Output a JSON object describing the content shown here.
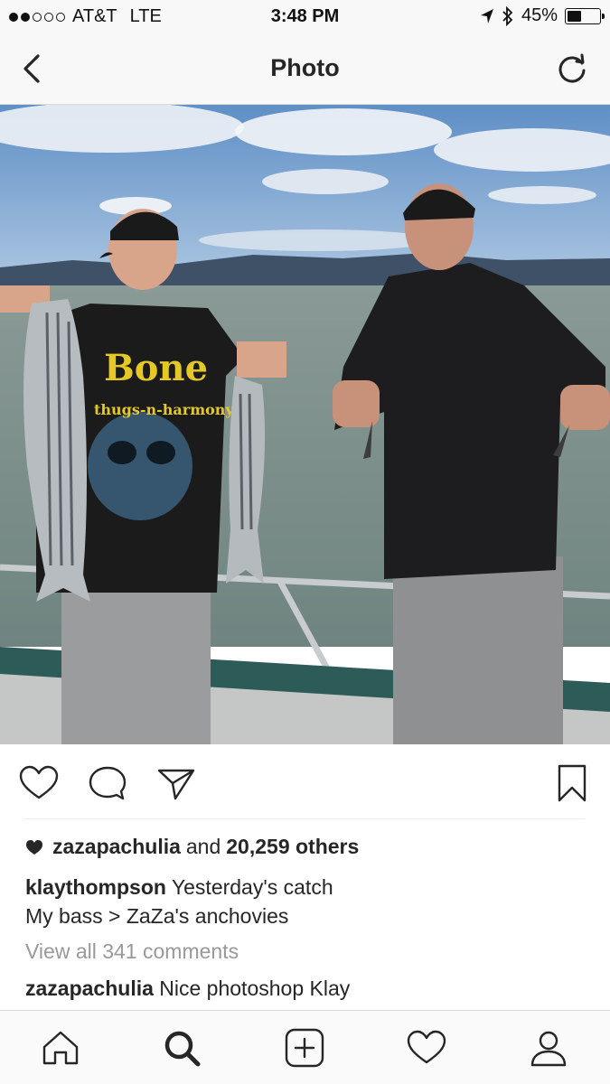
{
  "status_bar": {
    "carrier": "AT&T",
    "network": "LTE",
    "time": "3:48 PM",
    "battery_percent_label": "45%",
    "battery_level": 0.45,
    "signal_bars_filled": 2,
    "signal_bars_total": 5
  },
  "nav": {
    "title": "Photo",
    "back_icon": "chevron-left-icon",
    "refresh_icon": "refresh-icon"
  },
  "post": {
    "likes": {
      "user": "zazapachulia",
      "and_text": "and",
      "others": "20,259 others"
    },
    "caption": {
      "user": "klaythompson",
      "line1": "Yesterday's catch",
      "line2": "My bass > ZaZa's anchovies"
    },
    "view_all_comments": "View all 341 comments",
    "comment": {
      "user": "zazapachulia",
      "text": "Nice photoshop Klay"
    },
    "shirt_print": {
      "line1": "Bone",
      "line2": "thugs-n-harmony"
    }
  },
  "action_icons": [
    "heart-icon",
    "comment-icon",
    "share-icon",
    "bookmark-icon"
  ],
  "tab_icons": [
    "home-icon",
    "search-icon",
    "add-post-icon",
    "activity-heart-icon",
    "profile-icon"
  ],
  "colors": {
    "text": "#262626",
    "muted": "#999999",
    "bar_bg": "#f8f8f8",
    "divider": "#dbdbdb"
  }
}
